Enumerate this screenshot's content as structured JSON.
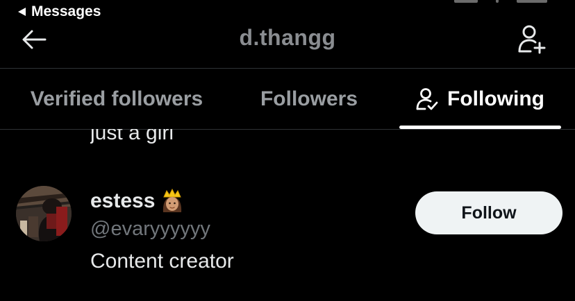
{
  "status_bar": {
    "back_app_label": "Messages"
  },
  "header": {
    "title": "d.thangg"
  },
  "tabs": [
    {
      "label": "Verified followers",
      "active": false
    },
    {
      "label": "Followers",
      "active": false
    },
    {
      "label": "Following",
      "active": true,
      "icon": "person-check-icon"
    }
  ],
  "list": {
    "previous_bio": "just a girl",
    "users": [
      {
        "display_name": "estess",
        "emoji": "princess-emoji",
        "handle": "@evaryyyyyy",
        "bio": "Content creator",
        "button_label": "Follow"
      }
    ]
  },
  "colors": {
    "background": "#000000",
    "text_primary": "#e7e9ea",
    "text_secondary": "#71767b",
    "divider": "#2f3336",
    "button_bg": "#eff3f4",
    "button_text": "#0f1419"
  }
}
